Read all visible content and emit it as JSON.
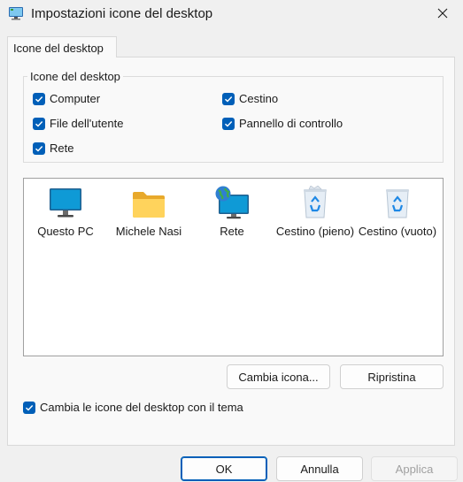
{
  "window": {
    "title": "Impostazioni icone del desktop"
  },
  "tab": {
    "label": "Icone del desktop"
  },
  "group": {
    "legend": "Icone del desktop",
    "checkboxes": [
      {
        "label": "Computer",
        "checked": true
      },
      {
        "label": "Cestino",
        "checked": true
      },
      {
        "label": "File dell'utente",
        "checked": true
      },
      {
        "label": "Pannello di controllo",
        "checked": true
      },
      {
        "label": "Rete",
        "checked": true
      }
    ]
  },
  "icons": [
    {
      "label": "Questo PC",
      "icon": "monitor-icon"
    },
    {
      "label": "Michele Nasi",
      "icon": "folder-icon"
    },
    {
      "label": "Rete",
      "icon": "network-icon"
    },
    {
      "label": "Cestino (pieno)",
      "icon": "recycle-bin-full-icon"
    },
    {
      "label": "Cestino (vuoto)",
      "icon": "recycle-bin-empty-icon"
    }
  ],
  "buttons": {
    "change_icon": "Cambia icona...",
    "restore": "Ripristina",
    "ok": "OK",
    "cancel": "Annulla",
    "apply": "Applica"
  },
  "theme_option": {
    "label": "Cambia le icone del desktop con il tema",
    "checked": true
  },
  "colors": {
    "accent": "#005fb8"
  }
}
